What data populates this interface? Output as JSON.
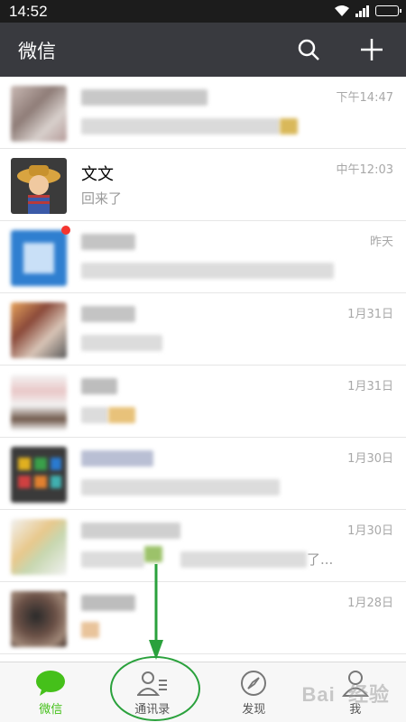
{
  "status_bar": {
    "time": "14:52"
  },
  "header": {
    "title": "微信"
  },
  "chats": [
    {
      "name": "",
      "message": "",
      "time": "下午14:47"
    },
    {
      "name": "文文",
      "message": "回来了",
      "time": "中午12:03"
    },
    {
      "name": "",
      "message": "",
      "time": "昨天",
      "unread": true
    },
    {
      "name": "",
      "message": "",
      "time": "1月31日"
    },
    {
      "name": "",
      "message": "",
      "time": "1月31日"
    },
    {
      "name": "",
      "message": "",
      "time": "1月30日"
    },
    {
      "name": "",
      "message": "了...",
      "time": "1月30日"
    },
    {
      "name": "",
      "message": "",
      "time": "1月28日"
    }
  ],
  "tabs": [
    {
      "label": "微信",
      "icon": "chat-bubble-icon",
      "active": true
    },
    {
      "label": "通讯录",
      "icon": "contacts-icon",
      "active": false
    },
    {
      "label": "发现",
      "icon": "compass-icon",
      "active": false
    },
    {
      "label": "我",
      "icon": "person-icon",
      "active": false
    }
  ],
  "watermark": "Bai  经验",
  "colors": {
    "accent": "#45c01a",
    "header_bg": "#393a3f",
    "annotation": "#2aa13c"
  }
}
